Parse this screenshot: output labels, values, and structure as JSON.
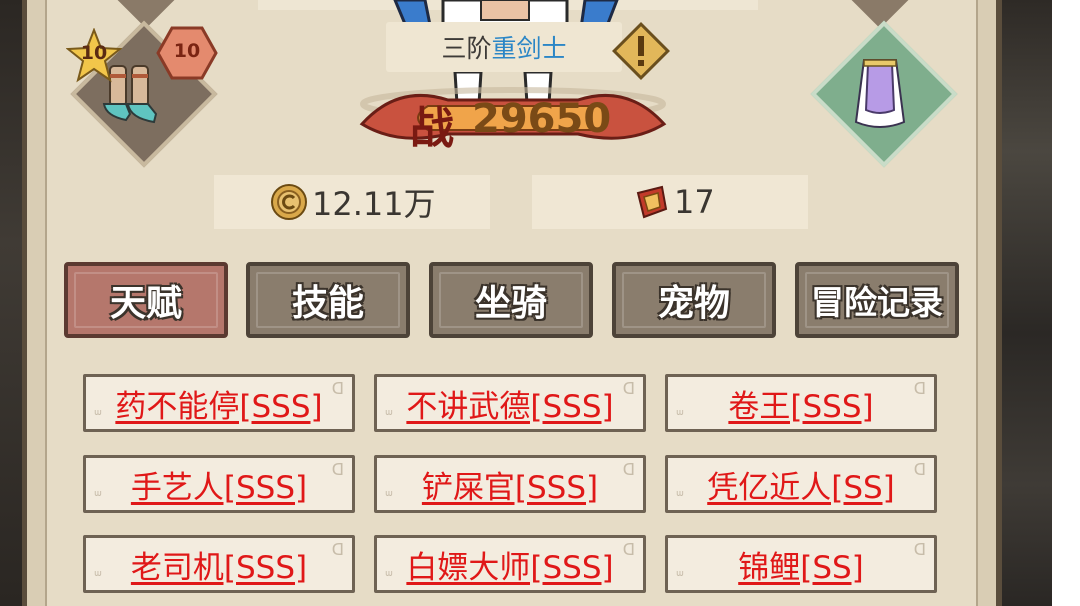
{
  "hero": {
    "rank": "三阶",
    "class_name": "重剑士",
    "power_label": "战",
    "power_value": "29650"
  },
  "equipment": {
    "boots_level_star": "10",
    "boots_level_hex": "10"
  },
  "stats": {
    "gold": "12.11万",
    "blood_token": "17"
  },
  "tabs": [
    {
      "label": "天赋",
      "active": true
    },
    {
      "label": "技能",
      "active": false
    },
    {
      "label": "坐骑",
      "active": false
    },
    {
      "label": "宠物",
      "active": false
    },
    {
      "label": "冒险记录",
      "active": false
    }
  ],
  "talents": [
    "药不能停[SSS]",
    "不讲武德[SSS]",
    "卷王[SSS]",
    "手艺人[SSS]",
    "铲屎官[SSS]",
    "凭亿近人[SS]",
    "老司机[SSS]",
    "白嫖大师[SSS]",
    "锦鲤[SS]"
  ],
  "colors": {
    "talent_text": "#e01818",
    "class_blue": "#2b86c6",
    "active_tab": "#b5776c",
    "inactive_tab": "#8a7d6d",
    "parchment": "#e6dcc6"
  }
}
